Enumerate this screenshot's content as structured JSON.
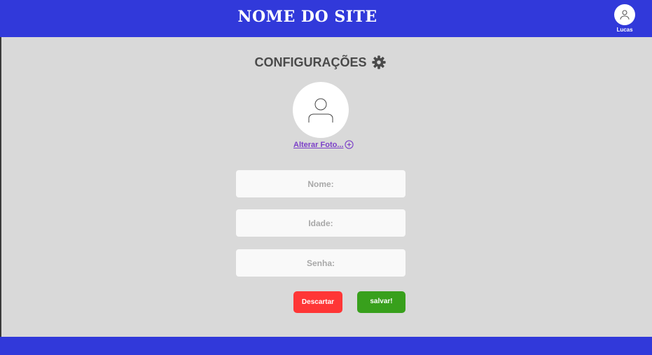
{
  "header": {
    "site_title": "NOME DO SITE",
    "user": {
      "name": "Lucas",
      "avatar_icon": "user-icon"
    }
  },
  "settings": {
    "title": "CONFIGURAÇÕES",
    "title_icon": "gear-icon",
    "profile_photo_icon": "user-icon",
    "change_photo_label": "Alterar Foto...",
    "change_photo_icon": "plus-circle-icon"
  },
  "form": {
    "name_placeholder": "Nome:",
    "age_placeholder": "Idade:",
    "password_placeholder": "Senha:"
  },
  "actions": {
    "discard_label": "Descartar",
    "save_label": "salvar!"
  },
  "colors": {
    "primary": "#3139da",
    "background": "#d9d9d9",
    "discard": "#ff3636",
    "save": "#38a01c",
    "link": "#7b3fc8"
  }
}
